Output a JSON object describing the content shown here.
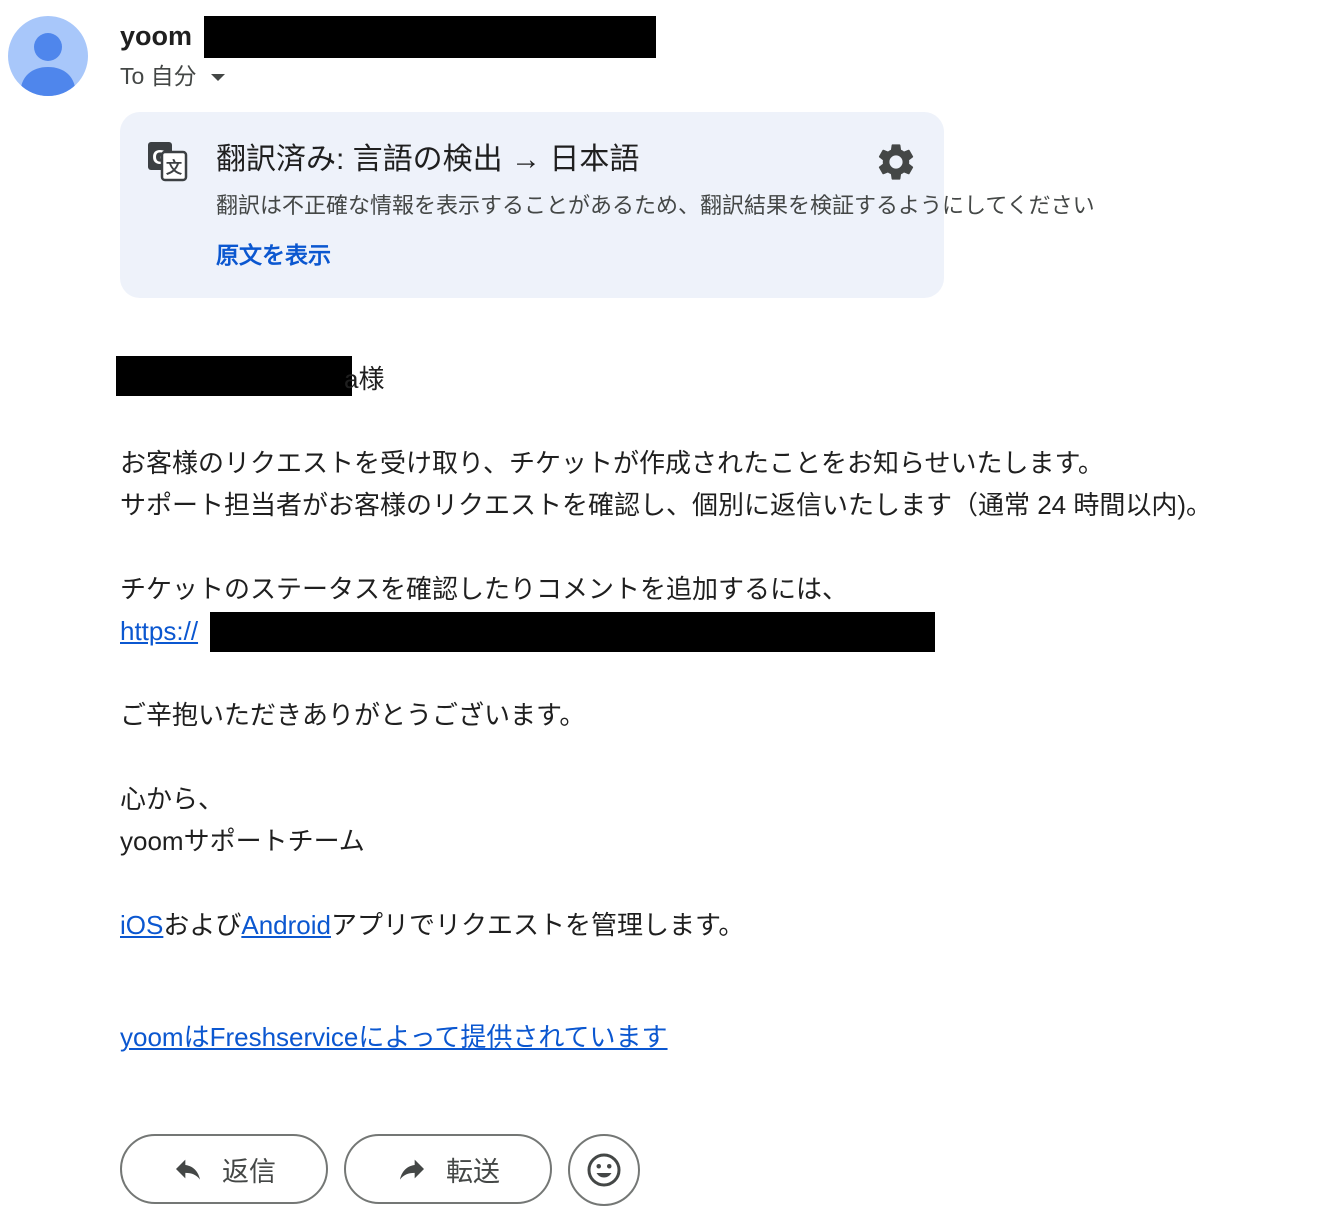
{
  "header": {
    "sender_name": "yoom",
    "to_label": "To 自分"
  },
  "translation": {
    "title": "翻訳済み: 言語の検出 → 日本語",
    "note": "翻訳は不正確な情報を表示することがあるため、翻訳結果を検証するようにしてください",
    "show_original": "原文を表示"
  },
  "message": {
    "greeting_suffix": "a様",
    "para1_line1": "お客様のリクエストを受け取り、チケットが作成されたことをお知らせいたします。",
    "para1_line2": "サポート担当者がお客様のリクエストを確認し、個別に返信いたします（通常 24 時間以内)。",
    "para2_line1": "チケットのステータスを確認したりコメントを追加するには、",
    "link_prefix": "https://",
    "thanks": "ご辛抱いただきありがとうございます。",
    "closing": "心から、",
    "signature": "yoomサポートチーム",
    "apps_ios": "iOS",
    "apps_and": "および",
    "apps_android": "Android",
    "apps_rest": "アプリでリクエストを管理します。",
    "powered_by": "yoomはFreshserviceによって提供されています"
  },
  "actions": {
    "reply": "返信",
    "forward": "転送"
  },
  "colors": {
    "link": "#0b57d0",
    "translate_bg": "#eef2fa",
    "avatar_bg": "#a8c7fa",
    "avatar_fg": "#4f86ec"
  },
  "icons": [
    "avatar-person-icon",
    "translate-icon",
    "gear-icon",
    "caret-down-icon",
    "reply-icon",
    "forward-icon",
    "emoji-icon"
  ]
}
